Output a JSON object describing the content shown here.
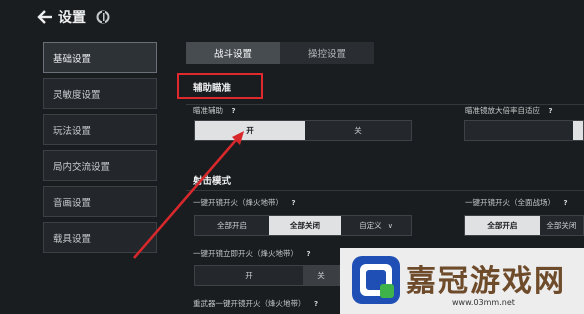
{
  "header": {
    "title": "设置",
    "back_icon": "back-arrow-icon",
    "logo_icon": "game-logo-icon"
  },
  "sidebar": {
    "items": [
      {
        "label": "基础设置",
        "active": true
      },
      {
        "label": "灵敏度设置",
        "active": false
      },
      {
        "label": "玩法设置",
        "active": false
      },
      {
        "label": "局内交流设置",
        "active": false
      },
      {
        "label": "音画设置",
        "active": false
      },
      {
        "label": "载具设置",
        "active": false
      }
    ]
  },
  "tabs": [
    {
      "label": "战斗设置",
      "active": true
    },
    {
      "label": "操控设置",
      "active": false
    }
  ],
  "aim_section": {
    "title": "辅助瞄准",
    "aim_assist": {
      "label": "瞄准辅助",
      "help": "?",
      "on_label": "开",
      "off_label": "关",
      "selected": "开"
    },
    "scope_adapt": {
      "label": "瞄准镜放大倍率自适应",
      "help": "?"
    }
  },
  "fire_section": {
    "title": "射击模式",
    "one_key_fire": {
      "label": "一键开镜开火（烽火地带）",
      "help": "?",
      "options": [
        "全部开启",
        "全部关闭",
        "自定义"
      ],
      "selected": "全部关闭",
      "dropdown_icon": "chevron-down-icon"
    },
    "one_key_fire_full": {
      "label": "一键开镜开火（全面战场）",
      "help": "?",
      "options": [
        "全部开启",
        "全部关闭"
      ],
      "selected": "全部开启"
    },
    "instant_fire": {
      "label": "一键开镜立即开火（烽火地带）",
      "help": "?",
      "options": [
        "开",
        "关"
      ]
    },
    "heavy_weapon": {
      "label": "重武器一键开镜开火（烽火地带）",
      "help": "?"
    }
  },
  "watermark": {
    "text": "嘉冠游戏网",
    "url": "www.03mm.net"
  },
  "colors": {
    "highlight": "#e0292c",
    "selected_option": "#dfe1e3",
    "background": "#1a1d20"
  }
}
